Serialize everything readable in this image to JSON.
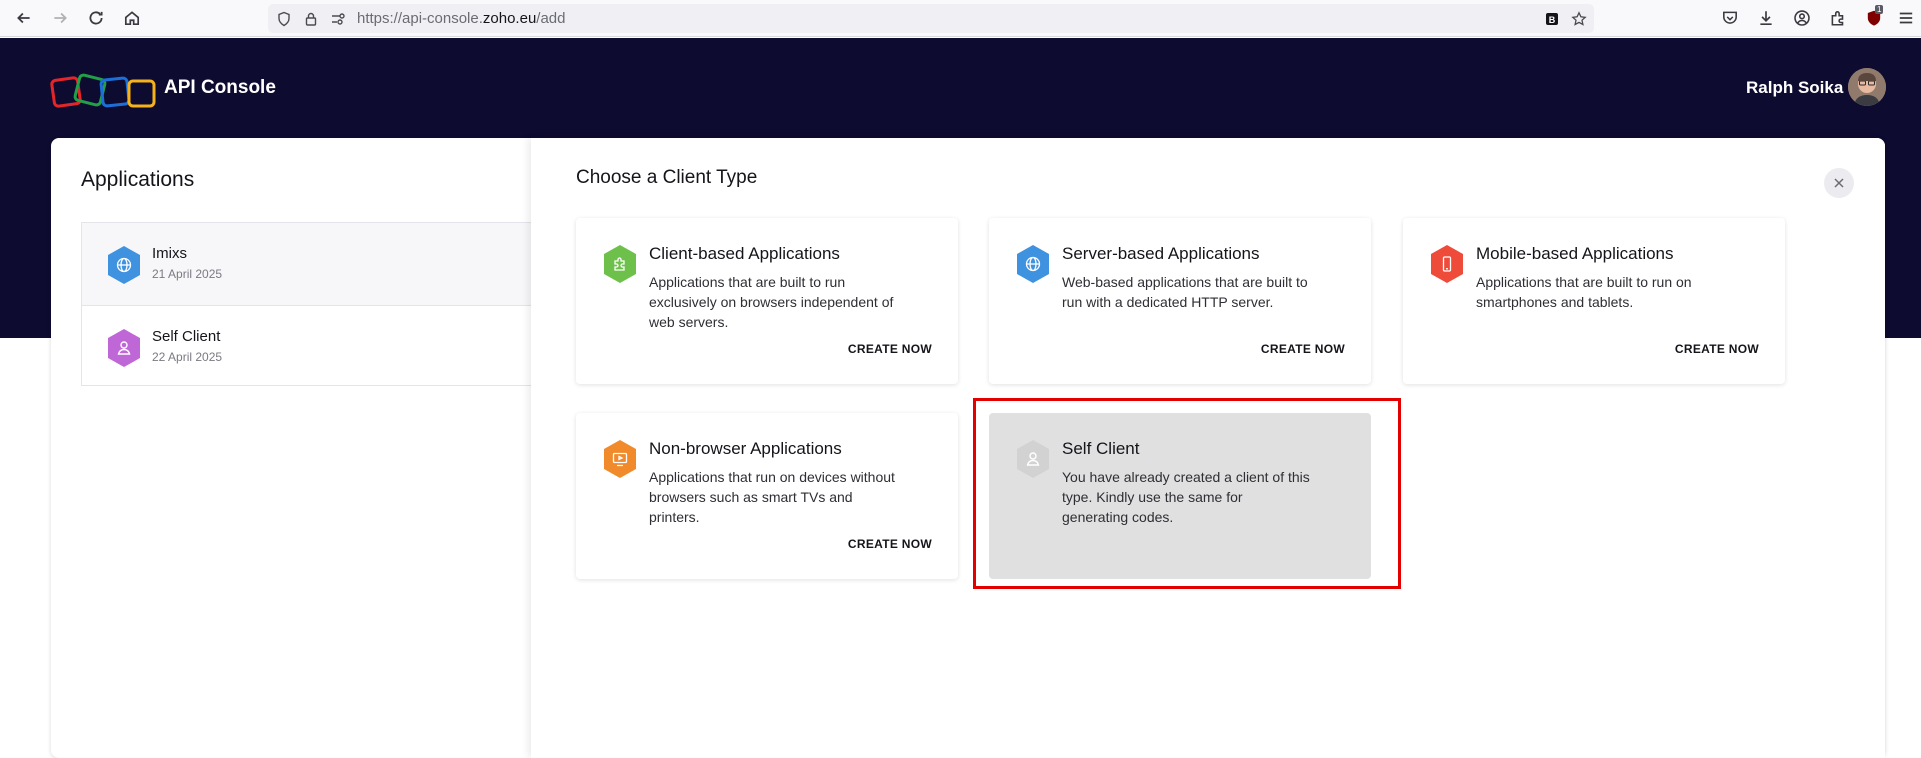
{
  "browser": {
    "url_prefix": "https://api-console.",
    "url_host": "zoho.eu",
    "url_path": "/add",
    "notification_count": "1"
  },
  "header": {
    "brand": "API Console",
    "user_name": "Ralph Soika"
  },
  "sidebar": {
    "title": "Applications",
    "apps": [
      {
        "name": "Imixs",
        "date": "21 April 2025",
        "icon": "globe-icon",
        "color": "#3f92e0"
      },
      {
        "name": "Self Client",
        "date": "22 April 2025",
        "icon": "person-icon",
        "color": "#c067d8"
      }
    ]
  },
  "modal": {
    "title": "Choose a Client Type",
    "cards": [
      {
        "title": "Client-based Applications",
        "description": "Applications that are built to run exclusively on browsers independent of web servers.",
        "cta": "CREATE NOW",
        "icon": "puzzle-icon",
        "color": "#6dc14a"
      },
      {
        "title": "Server-based Applications",
        "description": "Web-based applications that are built to run with a dedicated HTTP server.",
        "cta": "CREATE NOW",
        "icon": "globe-icon",
        "color": "#3f92e0"
      },
      {
        "title": "Mobile-based Applications",
        "description": "Applications that are built to run on smartphones and tablets.",
        "cta": "CREATE NOW",
        "icon": "phone-icon",
        "color": "#ee4b3b"
      },
      {
        "title": "Non-browser Applications",
        "description": "Applications that run on devices without browsers such as smart TVs and printers.",
        "cta": "CREATE NOW",
        "icon": "tv-icon",
        "color": "#f18a2a"
      },
      {
        "title": "Self Client",
        "description": "You have already created a client of this type. Kindly use the same for generating codes.",
        "cta": "",
        "icon": "person-icon",
        "color": "#d2d2d2"
      }
    ]
  },
  "colors": {
    "header_bg": "#0e0b30",
    "highlight": "#e50000",
    "disabled_card": "#e0e0e0"
  }
}
